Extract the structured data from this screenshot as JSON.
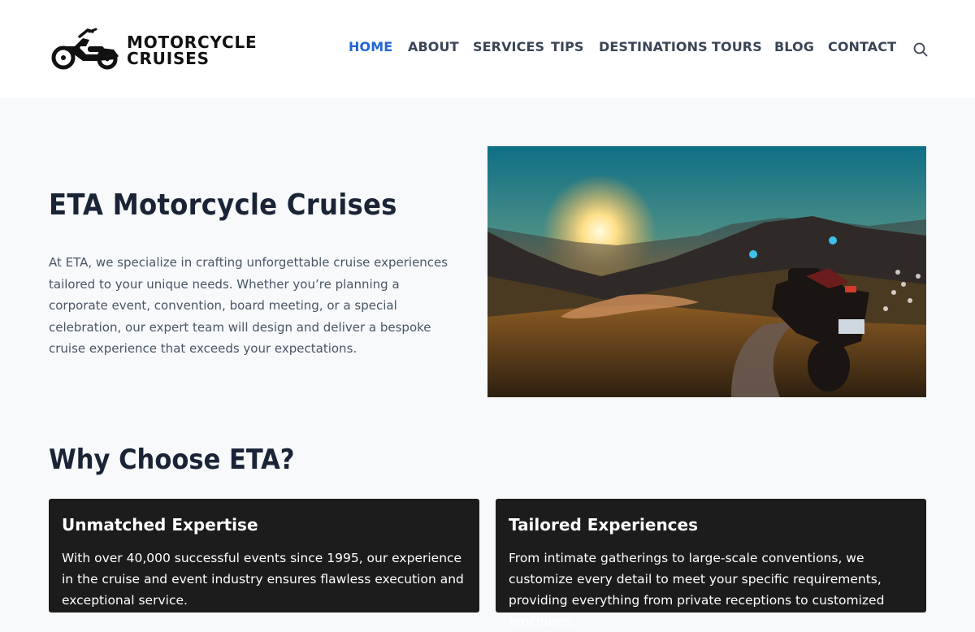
{
  "brand": {
    "line1": "MOTORCYCLE",
    "line2": "CRUISES",
    "logo_icon": "motorcycle-icon"
  },
  "nav": {
    "items": [
      {
        "label": "HOME",
        "active": true
      },
      {
        "label": "ABOUT",
        "active": false
      },
      {
        "label": "SERVICES",
        "active": false
      },
      {
        "label": "TIPS",
        "active": false
      },
      {
        "label": "DESTINATIONS",
        "active": false
      },
      {
        "label": "TOURS",
        "active": false
      },
      {
        "label": "BLOG",
        "active": false
      },
      {
        "label": "CONTACT",
        "active": false
      }
    ],
    "search_icon": "search-icon"
  },
  "hero": {
    "title": "ETA Motorcycle Cruises",
    "text": "At ETA, we specialize in crafting unforgettable cruise experiences tailored to your unique needs. Whether you’re planning a corporate event, convention, board meeting, or a special celebration, our expert team will design and deliver a bespoke cruise experience that exceeds your expectations.",
    "image": "motorcycle-at-mountain-sunset-image"
  },
  "why": {
    "title": "Why Choose ETA?",
    "cards": [
      {
        "title": "Unmatched Expertise",
        "text": "With over 40,000 successful events since 1995, our experience in the cruise and event industry ensures flawless execution and exceptional service."
      },
      {
        "title": "Tailored Experiences",
        "text": "From intimate gatherings to large-scale conventions, we customize every detail to meet your specific requirements, providing everything from private receptions to customized brochures."
      }
    ]
  },
  "colors": {
    "accent": "#2166d4",
    "nav_text": "#3a4656",
    "heading": "#1a2436",
    "card_bg": "#1c1c1c",
    "page_bg": "#f7f9fb"
  }
}
